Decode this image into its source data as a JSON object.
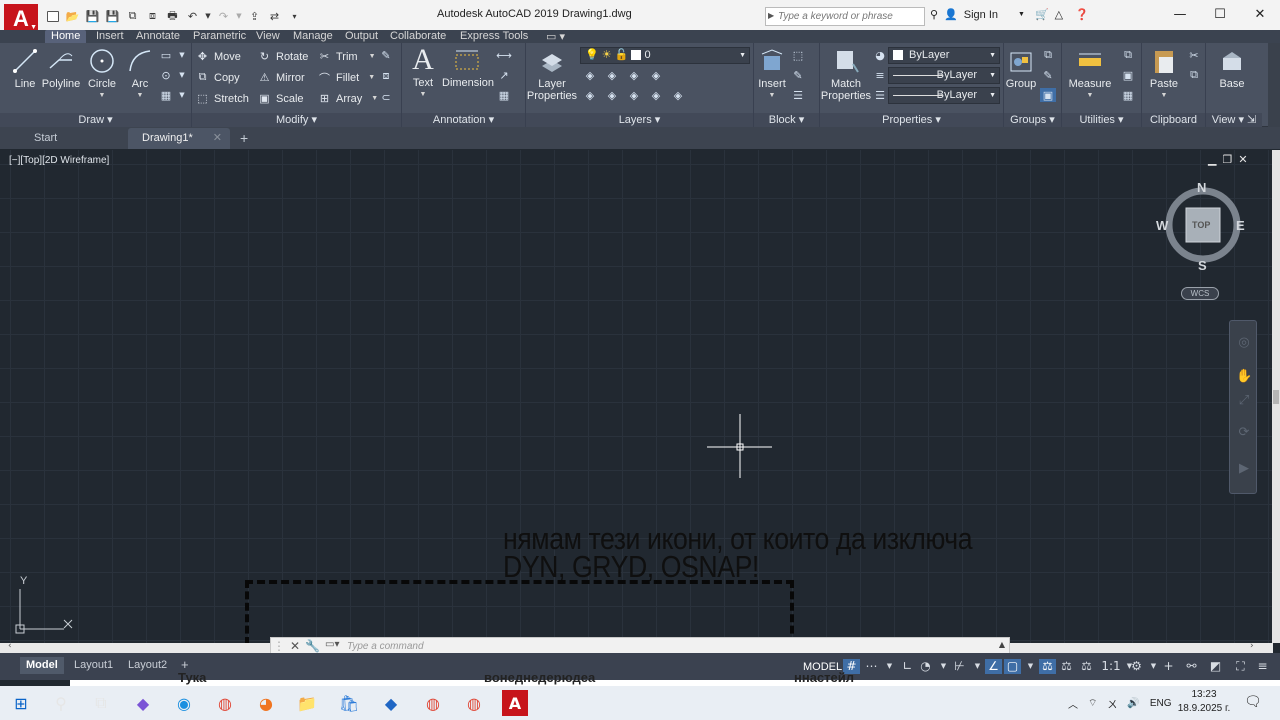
{
  "titlebar": {
    "app_title": "Autodesk AutoCAD 2019",
    "doc_name": "Drawing1.dwg",
    "search_placeholder": "Type a keyword or phrase",
    "sign_in": "Sign In",
    "logo_letter": "A"
  },
  "ribbon_tabs": [
    "Home",
    "Insert",
    "Annotate",
    "Parametric",
    "View",
    "Manage",
    "Output",
    "Collaborate",
    "Express Tools"
  ],
  "panels": {
    "draw": {
      "title": "Draw",
      "line": "Line",
      "polyline": "Polyline",
      "circle": "Circle",
      "arc": "Arc"
    },
    "modify": {
      "title": "Modify",
      "move": "Move",
      "rotate": "Rotate",
      "trim": "Trim",
      "copy": "Copy",
      "mirror": "Mirror",
      "fillet": "Fillet",
      "stretch": "Stretch",
      "scale": "Scale",
      "array": "Array"
    },
    "annotation": {
      "title": "Annotation",
      "text": "Text",
      "dimension": "Dimension"
    },
    "layers": {
      "title": "Layers",
      "layer_properties_1": "Layer",
      "layer_properties_2": "Properties",
      "current_layer": "0"
    },
    "block": {
      "title": "Block",
      "insert": "Insert"
    },
    "properties": {
      "title": "Properties",
      "match_1": "Match",
      "match_2": "Properties",
      "color": "ByLayer",
      "linetype": "ByLayer",
      "lineweight": "ByLayer"
    },
    "groups": {
      "title": "Groups",
      "group": "Group"
    },
    "utilities": {
      "title": "Utilities",
      "measure": "Measure"
    },
    "clipboard": {
      "title": "Clipboard",
      "paste": "Paste"
    },
    "view": {
      "title": "View",
      "base": "Base"
    }
  },
  "doc_tabs": {
    "start": "Start",
    "drawing": "Drawing1*"
  },
  "viewport": {
    "label": "[−][Top][2D Wireframe]",
    "cube": {
      "n": "N",
      "s": "S",
      "e": "E",
      "w": "W",
      "face": "TOP",
      "wcs": "WCS"
    },
    "ucs_y": "Y"
  },
  "overlay_text": {
    "line1": "нямам тези икони, от които да изключа",
    "line2": "DYN, GRYD, OSNAP!"
  },
  "command": {
    "placeholder": "Type a command"
  },
  "layout_tabs": [
    "Model",
    "Layout1",
    "Layout2"
  ],
  "status": {
    "model": "MODEL",
    "scale": "1:1"
  },
  "photo_words": {
    "left": "Тука",
    "mid": "вонеднедерюдеа",
    "right": "ннастейл"
  },
  "tray": {
    "lang": "ENG",
    "time": "13:23",
    "date": "18.9.2025 г."
  }
}
